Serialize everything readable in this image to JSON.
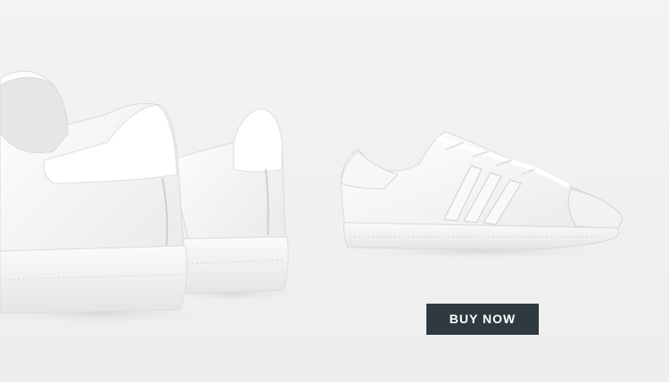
{
  "banner": {
    "buy_button_label": "BUY NOW",
    "background_color": "#f1f1f1",
    "button_color": "#2f3a40",
    "left_image": "white-sneakers-rear-view",
    "right_image": "white-sneaker-side-view"
  }
}
